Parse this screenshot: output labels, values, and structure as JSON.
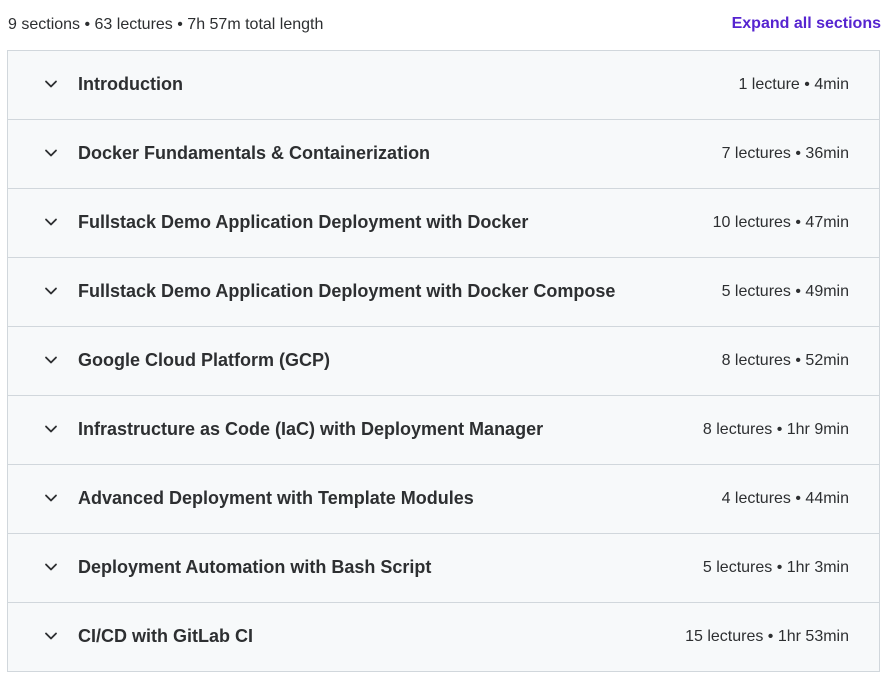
{
  "summary": {
    "text": "9 sections • 63 lectures • 7h 57m total length",
    "expand_label": "Expand all sections"
  },
  "colors": {
    "accent": "#5624d0",
    "text": "#2d2f31",
    "row_bg": "#f7f9fa",
    "border": "#d1d7dc"
  },
  "sections": [
    {
      "title": "Introduction",
      "meta": "1 lecture • 4min"
    },
    {
      "title": "Docker Fundamentals & Containerization",
      "meta": "7 lectures • 36min"
    },
    {
      "title": "Fullstack Demo Application Deployment with Docker",
      "meta": "10 lectures • 47min"
    },
    {
      "title": "Fullstack Demo Application Deployment with Docker Compose",
      "meta": "5 lectures • 49min"
    },
    {
      "title": "Google Cloud Platform (GCP)",
      "meta": "8 lectures • 52min"
    },
    {
      "title": "Infrastructure as Code (IaC) with Deployment Manager",
      "meta": "8 lectures • 1hr 9min"
    },
    {
      "title": "Advanced Deployment with Template Modules",
      "meta": "4 lectures • 44min"
    },
    {
      "title": "Deployment Automation with Bash Script",
      "meta": "5 lectures • 1hr 3min"
    },
    {
      "title": "CI/CD with GitLab CI",
      "meta": "15 lectures • 1hr 53min"
    }
  ],
  "icons": {
    "section_toggle": "chevron-down-icon"
  }
}
